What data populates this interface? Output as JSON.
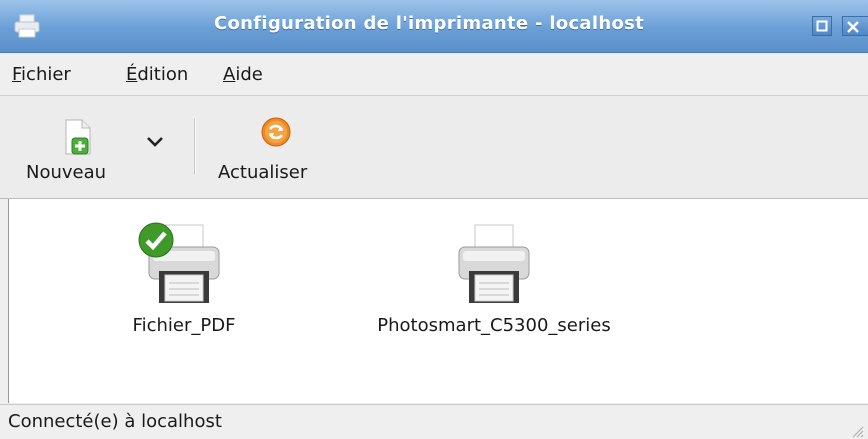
{
  "window": {
    "title": "Configuration de l'imprimante - localhost",
    "accent_color": "#6a9fd6",
    "title_icon": "printer-icon"
  },
  "menubar": {
    "items": [
      {
        "label": "Fichier",
        "mnemonic": "F",
        "rest": "ichier"
      },
      {
        "label": "Édition",
        "mnemonic": "É",
        "rest": "dition"
      },
      {
        "label": "Aide",
        "mnemonic": "A",
        "rest": "ide"
      }
    ]
  },
  "toolbar": {
    "new_label": "Nouveau",
    "new_icon": "new-document-plus-icon",
    "dropdown_icon": "chevron-down-icon",
    "refresh_label": "Actualiser",
    "refresh_icon": "refresh-icon"
  },
  "printers": [
    {
      "name": "Fichier_PDF",
      "default": true,
      "badge_icon": "default-check-icon"
    },
    {
      "name": "Photosmart_C5300_series",
      "default": false
    }
  ],
  "statusbar": {
    "text": "Connecté(e) à localhost"
  }
}
